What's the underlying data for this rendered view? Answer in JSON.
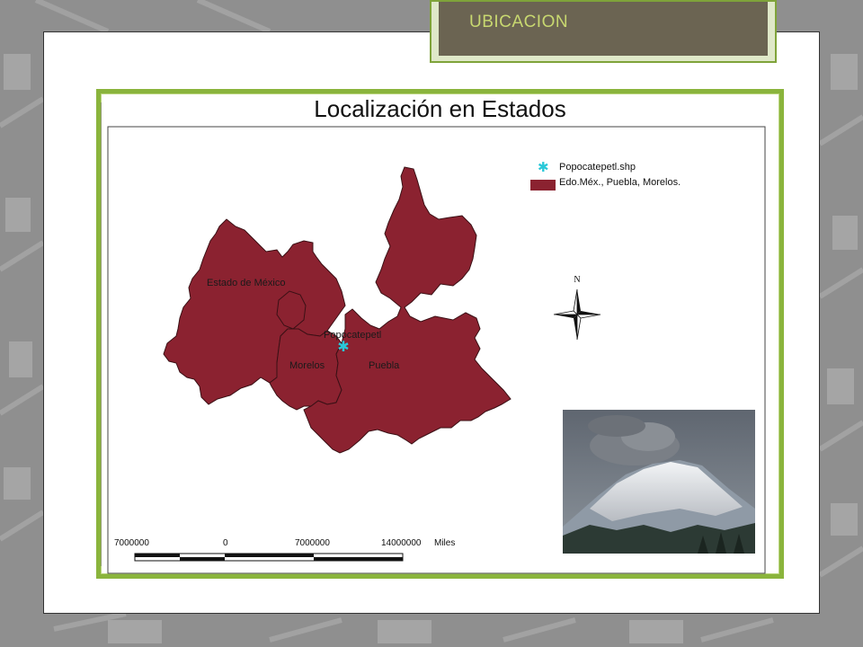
{
  "slide": {
    "title": "UBICACION"
  },
  "map": {
    "title": "Localización en Estados",
    "region_labels": {
      "estado_de_mexico": "Estado de México",
      "morelos": "Morelos",
      "puebla": "Puebla",
      "popocatepetl": "Popocatepetl"
    },
    "legend": [
      {
        "label": "Popocatepetl.shp",
        "symbol": "star",
        "color": "#29c8d8"
      },
      {
        "label": "Edo.Méx., Puebla, Morelos.",
        "symbol": "polygon",
        "color": "#8b2230"
      }
    ],
    "north_arrow": "N",
    "scale_bar": {
      "ticks": [
        "7000000",
        "0",
        "7000000",
        "14000000"
      ],
      "unit": "Miles"
    },
    "photo_description_icon": "volcano-photo"
  },
  "colors": {
    "background": "#8f8f8f",
    "accent_green": "#8ab43c",
    "title_tab": "#6b6452",
    "title_text": "#c8d870",
    "states_fill": "#8b2230",
    "volcano_marker": "#29c8d8"
  }
}
